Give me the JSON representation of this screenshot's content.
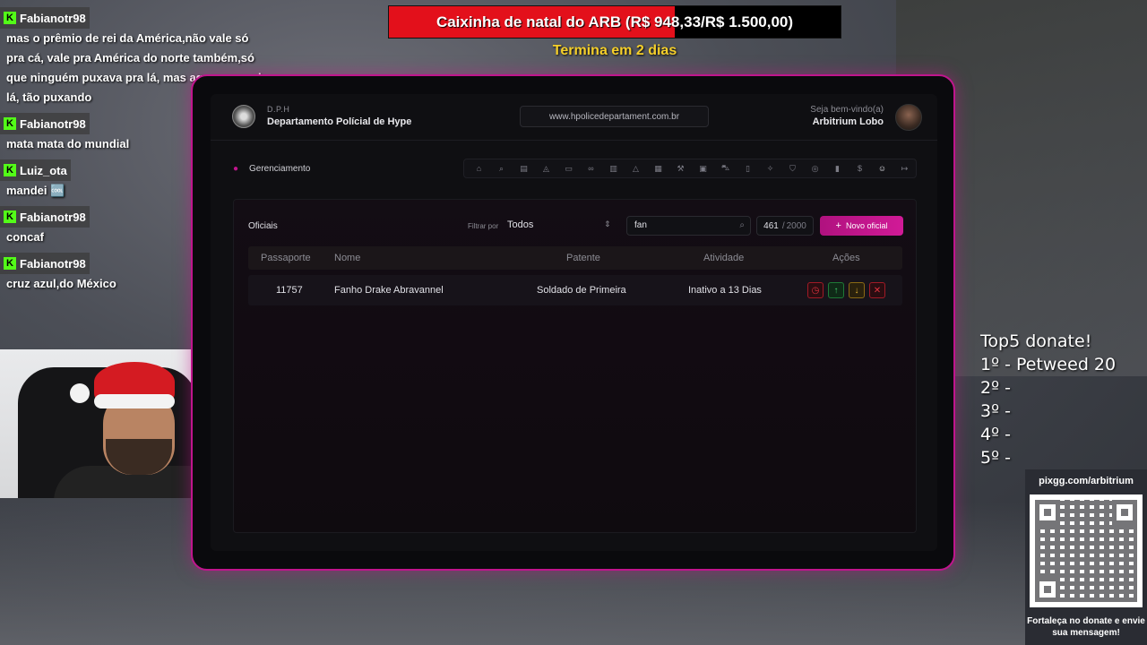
{
  "goal": {
    "text": "Caixinha de natal do ARB (R$ 948,33/R$ 1.500,00)",
    "progress_fraction": 0.632,
    "subtext": "Termina em 2 dias",
    "fill_color": "#e3101b",
    "subtext_color": "#f5cf2a"
  },
  "chat": [
    {
      "user": "Fabianotr98",
      "text": "mas o prêmio de rei da América,não vale só pra cá, vale pra América do norte também,só que ninguém puxava pra lá, mas agora com ele lá, tão puxando"
    },
    {
      "user": "Fabianotr98",
      "text": "mata mata do mundial"
    },
    {
      "user": "Luiz_ota",
      "text": "mandei 🆒"
    },
    {
      "user": "Fabianotr98",
      "text": "concaf"
    },
    {
      "user": "Fabianotr98",
      "text": "cruz azul,do México"
    }
  ],
  "app": {
    "dept_abbr": "D.P.H",
    "dept_name": "Departamento Polícial de Hype",
    "url": "www.hpolicedepartament.com.br",
    "welcome": "Seja bem-vindo(a)",
    "username": "Arbitrium Lobo",
    "section": "Gerenciamento",
    "nav_icons": [
      "home-icon",
      "search-icon",
      "clipboard-icon",
      "siren-icon",
      "folder-icon",
      "handcuffs-icon",
      "book-icon",
      "warning-icon",
      "document-icon",
      "gavel-icon",
      "id-card-icon",
      "car-icon",
      "file-icon",
      "medal-icon",
      "shield-icon",
      "target-icon",
      "chart-icon",
      "dollar-icon",
      "users-icon",
      "logout-icon"
    ],
    "accent_color": "#c0158d"
  },
  "panel": {
    "title": "Oficiais",
    "filter_label": "Filtrar por",
    "filter_value": "Todos",
    "search_value": "fan",
    "count_current": "461",
    "count_max": "2000",
    "new_button": "Novo oficial",
    "columns": [
      "Passaporte",
      "Nome",
      "Patente",
      "Atividade",
      "Ações"
    ],
    "rows": [
      {
        "passport": "11757",
        "name": "Fanho Drake Abravannel",
        "rank": "Soldado de Primeira",
        "activity": "Inativo a 13 Dias"
      }
    ]
  },
  "top5": {
    "title": "Top5 donate!",
    "entries": [
      "1º -  Petweed 20",
      "2º -",
      "3º -",
      "4º -",
      "5º -"
    ]
  },
  "qr": {
    "title": "pixgg.com/arbitrium",
    "footer": "Fortaleça no donate e envie sua mensagem!"
  }
}
